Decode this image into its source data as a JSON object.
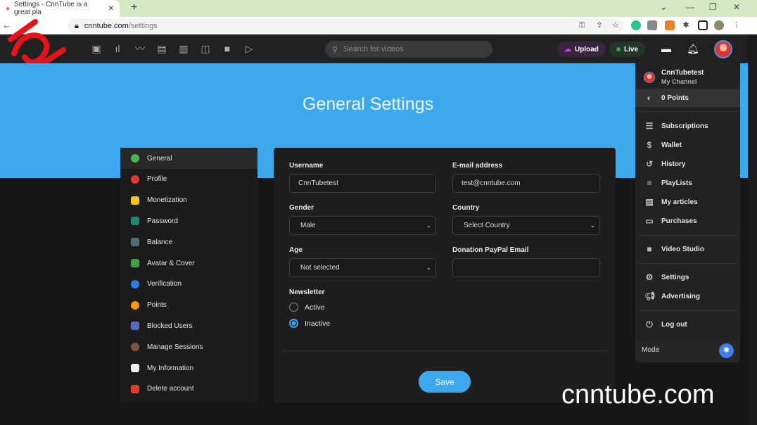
{
  "browser": {
    "tab_title": "Settings - CnnTube is a great pla",
    "url_host": "cnntube.com",
    "url_path": "/settings"
  },
  "header": {
    "search_placeholder": "Search for videos",
    "upload_label": "Upload",
    "live_label": "Live",
    "nav_icons": [
      "videos-icon",
      "chart-bar-icon",
      "trending-icon",
      "dashboard-icon",
      "film-icon",
      "carousel-icon",
      "camera-icon",
      "play-icon"
    ]
  },
  "banner": {
    "title": "General Settings"
  },
  "sidebar": {
    "items": [
      {
        "label": "General",
        "color": "#4caf50",
        "active": true
      },
      {
        "label": "Profile",
        "color": "#e53935"
      },
      {
        "label": "Monetization",
        "color": "#f5c518"
      },
      {
        "label": "Password",
        "color": "#1e8a72"
      },
      {
        "label": "Balance",
        "color": "#546e7a"
      },
      {
        "label": "Avatar & Cover",
        "color": "#43a047"
      },
      {
        "label": "Verification",
        "color": "#2f7be8"
      },
      {
        "label": "Points",
        "color": "#ff9800"
      },
      {
        "label": "Blocked Users",
        "color": "#5c6bc0"
      },
      {
        "label": "Manage Sessions",
        "color": "#795548"
      },
      {
        "label": "My Information",
        "color": "#eeeeee"
      },
      {
        "label": "Delete account",
        "color": "#e53935"
      }
    ]
  },
  "form": {
    "username": {
      "label": "Username",
      "value": "CnnTubetest"
    },
    "email": {
      "label": "E-mail address",
      "value": "test@cnntube.com"
    },
    "gender": {
      "label": "Gender",
      "value": "Male"
    },
    "country": {
      "label": "Country",
      "value": "Select Country"
    },
    "age": {
      "label": "Age",
      "value": "Not selected"
    },
    "paypal": {
      "label": "Donation PayPal Email",
      "value": ""
    },
    "newsletter": {
      "label": "Newsletter",
      "options": [
        "Active",
        "Inactive"
      ],
      "selected": "Inactive"
    },
    "save_label": "Save"
  },
  "menu": {
    "user_name": "CnnTubetest",
    "user_sub": "My Channel",
    "points": "0 Points",
    "items": [
      "Subscriptions",
      "Wallet",
      "History",
      "PlayLists",
      "My articles",
      "Purchases",
      "Video Studio",
      "Settings",
      "Advertising",
      "Log out"
    ],
    "mode_label": "Mode"
  },
  "watermark": "cnntube.com",
  "colors": {
    "accent": "#3da8ee",
    "upload": "#b23fd6",
    "live": "#3bb34a"
  }
}
